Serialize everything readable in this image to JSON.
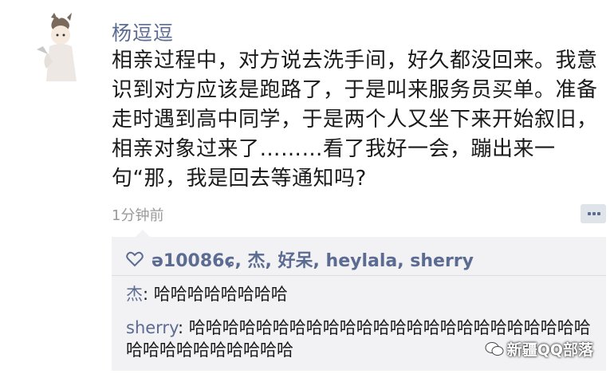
{
  "post": {
    "username": "杨逗逗",
    "text": "相亲过程中，对方说去洗手间，好久都没回来。我意识到对方应该是跑路了，于是叫来服务员买单。准备走时遇到高中同学，于是两个人又坐下来开始叙旧，相亲对象过来了………看了我好一会，蹦出来一句“那，我是回去等通知吗?",
    "timestamp": "1分钟前"
  },
  "likes": {
    "names": "ə10086ɕ, 杰, 好呆, heylala, sherry"
  },
  "comments": [
    {
      "author": "杰",
      "separator": ": ",
      "text": "哈哈哈哈哈哈哈哈"
    },
    {
      "author": "sherry",
      "separator": ": ",
      "text": "哈哈哈哈哈哈哈哈哈哈哈哈哈哈哈哈哈哈哈哈哈哈哈哈哈哈哈哈哈哈哈哈哈哈"
    }
  ],
  "watermark": {
    "text": "新疆QQ部落"
  },
  "colors": {
    "name_blue": "#5b6b92",
    "box_bg": "#f2f2f4"
  }
}
